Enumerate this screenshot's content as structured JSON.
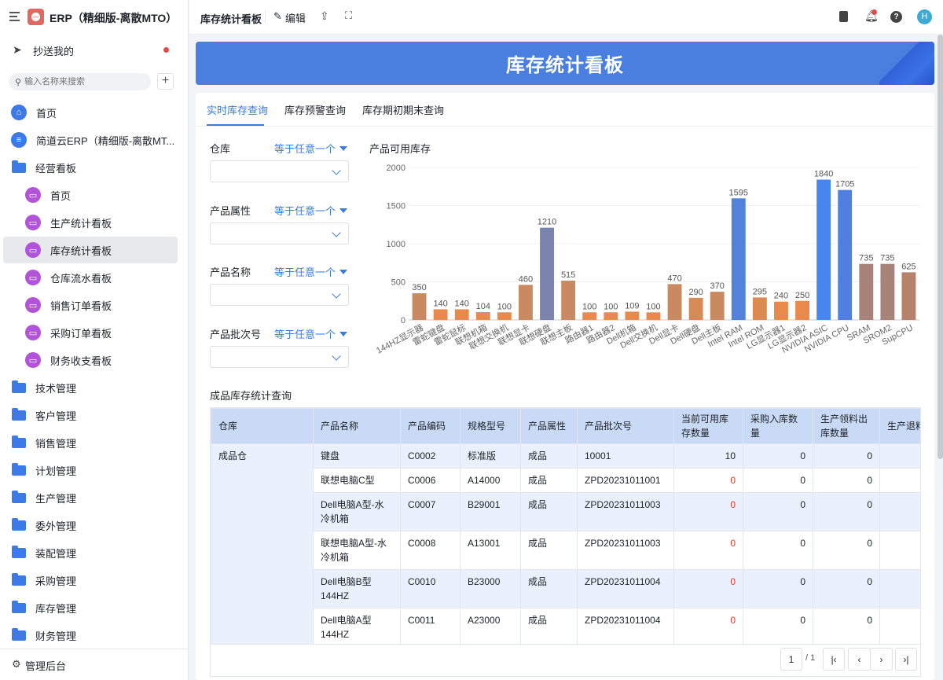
{
  "app": {
    "title": "ERP（精细版-离散MTO）",
    "logo_text": "ERP"
  },
  "sidebar": {
    "cc_label": "抄送我的",
    "search_placeholder": "输入名称来搜索",
    "items": [
      {
        "label": "首页",
        "icon": "home-icon"
      },
      {
        "label": "简道云ERP（精细版-离散MT...",
        "icon": "document-icon"
      },
      {
        "label": "经营看板",
        "icon": "folder-open-icon"
      },
      {
        "label": "首页",
        "icon": "dashboard-icon"
      },
      {
        "label": "生产统计看板",
        "icon": "dashboard-icon"
      },
      {
        "label": "库存统计看板",
        "icon": "dashboard-icon",
        "active": true
      },
      {
        "label": "仓库流水看板",
        "icon": "dashboard-icon"
      },
      {
        "label": "销售订单看板",
        "icon": "dashboard-icon"
      },
      {
        "label": "采购订单看板",
        "icon": "dashboard-icon"
      },
      {
        "label": "财务收支看板",
        "icon": "dashboard-icon"
      },
      {
        "label": "技术管理",
        "icon": "folder-icon"
      },
      {
        "label": "客户管理",
        "icon": "folder-icon"
      },
      {
        "label": "销售管理",
        "icon": "folder-icon"
      },
      {
        "label": "计划管理",
        "icon": "folder-icon"
      },
      {
        "label": "生产管理",
        "icon": "folder-icon"
      },
      {
        "label": "委外管理",
        "icon": "folder-icon"
      },
      {
        "label": "装配管理",
        "icon": "folder-icon"
      },
      {
        "label": "采购管理",
        "icon": "folder-icon"
      },
      {
        "label": "库存管理",
        "icon": "folder-icon"
      },
      {
        "label": "财务管理",
        "icon": "folder-icon"
      }
    ],
    "admin_label": "管理后台"
  },
  "header": {
    "page_title": "库存统计看板",
    "edit_label": "编辑",
    "avatar": "H"
  },
  "banner": {
    "title": "库存统计看板"
  },
  "tabs": [
    {
      "label": "实时库存查询",
      "active": true
    },
    {
      "label": "库存预警查询"
    },
    {
      "label": "库存期初期末查询"
    }
  ],
  "filters": [
    {
      "label": "仓库",
      "op": "等于任意一个"
    },
    {
      "label": "产品属性",
      "op": "等于任意一个"
    },
    {
      "label": "产品名称",
      "op": "等于任意一个"
    },
    {
      "label": "产品批次号",
      "op": "等于任意一个"
    }
  ],
  "chart_data": {
    "type": "bar",
    "title": "产品可用库存",
    "categories": [
      "144HZ显示器",
      "雷蛇键盘",
      "雷蛇鼠标",
      "联想机箱",
      "联想交换机",
      "联想显卡",
      "联想硬盘",
      "联想主板",
      "路由器1",
      "路由器2",
      "Dell机箱",
      "Dell交换机",
      "Dell显卡",
      "Dell硬盘",
      "Dell主板",
      "Intel RAM",
      "Intel ROM",
      "LG显示器1",
      "LG显示器2",
      "NVIDIA ASIC",
      "NVIDIA CPU",
      "SRAM",
      "SROM2",
      "SupCPU"
    ],
    "values": [
      350,
      140,
      140,
      104,
      100,
      460,
      1210,
      515,
      100,
      100,
      109,
      100,
      470,
      290,
      370,
      1595,
      295,
      240,
      250,
      1840,
      1705,
      735,
      735,
      625
    ],
    "colors": [
      "#c98a62",
      "#e98a4c",
      "#e98a4c",
      "#e98a4c",
      "#e98a4c",
      "#c98a62",
      "#7a84ae",
      "#c98a62",
      "#e98a4c",
      "#e98a4c",
      "#e98a4c",
      "#e98a4c",
      "#c98a62",
      "#d88a56",
      "#c98a62",
      "#5283db",
      "#dd8a52",
      "#e98a4c",
      "#e98a4c",
      "#4785ef",
      "#4f80e0",
      "#a8837a",
      "#a8837a",
      "#b5826a"
    ],
    "yticks": [
      0,
      500,
      1000,
      1500,
      2000
    ],
    "ylim": [
      0,
      2000
    ],
    "grid": true
  },
  "table": {
    "title": "成品库存统计查询",
    "columns": [
      "仓库",
      "产品名称",
      "产品编码",
      "规格型号",
      "产品属性",
      "产品批次号",
      "当前可用库存数量",
      "采购入库数量",
      "生产领料出库数量",
      "生产退料数量"
    ],
    "group": "成品仓",
    "rows": [
      [
        "键盘",
        "C0002",
        "标准版",
        "成品",
        "10001",
        "10",
        "0",
        "0"
      ],
      [
        "联想电脑C型",
        "C0006",
        "A14000",
        "成品",
        "ZPD20231011001",
        "0",
        "0",
        "0"
      ],
      [
        "Dell电脑A型-水冷机箱",
        "C0007",
        "B29001",
        "成品",
        "ZPD20231011003",
        "0",
        "0",
        "0"
      ],
      [
        "联想电脑A型-水冷机箱",
        "C0008",
        "A13001",
        "成品",
        "ZPD20231011003",
        "0",
        "0",
        "0"
      ],
      [
        "Dell电脑B型144HZ",
        "C0010",
        "B23000",
        "成品",
        "ZPD20231011004",
        "0",
        "0",
        "0"
      ],
      [
        "Dell电脑A型144HZ",
        "C0011",
        "A23000",
        "成品",
        "ZPD20231011004",
        "0",
        "0",
        "0"
      ]
    ]
  },
  "pagination": {
    "page": "1",
    "total": "/ 1"
  }
}
